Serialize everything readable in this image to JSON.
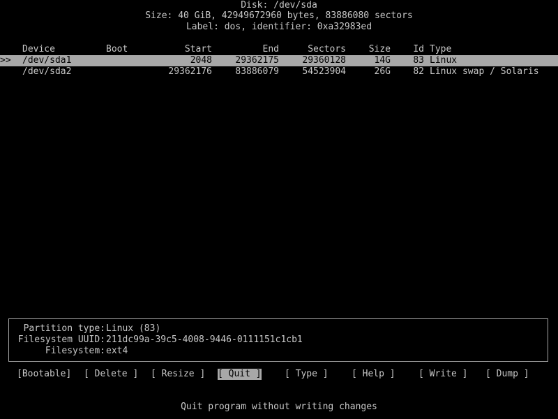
{
  "header": {
    "disk": "Disk: /dev/sda",
    "size": "Size: 40 GiB, 42949672960 bytes, 83886080 sectors",
    "label": "Label: dos, identifier: 0xa32983ed"
  },
  "table": {
    "columns": {
      "device": "Device",
      "boot": "Boot",
      "start": "Start",
      "end": "End",
      "sectors": "Sectors",
      "size": "Size",
      "id": "Id",
      "type": "Type"
    },
    "rows": [
      {
        "marker": ">>",
        "device": "/dev/sda1",
        "boot": "",
        "start": "2048",
        "end": "29362175",
        "sectors": "29360128",
        "size": "14G",
        "id": "83",
        "type": "Linux"
      },
      {
        "marker": "",
        "device": "/dev/sda2",
        "boot": "",
        "start": "29362176",
        "end": "83886079",
        "sectors": "54523904",
        "size": "26G",
        "id": "82",
        "type": "Linux swap / Solaris"
      }
    ]
  },
  "info": {
    "partition_type_label": "Partition type:",
    "partition_type_value": "Linux (83)",
    "uuid_label": "Filesystem UUID:",
    "uuid_value": "211dc99a-39c5-4008-9446-0111151c1cb1",
    "filesystem_label": "Filesystem:",
    "filesystem_value": "ext4"
  },
  "menu": {
    "bootable": "[Bootable]",
    "delete": "[ Delete ]",
    "resize": "[ Resize ]",
    "quit": "[ Quit ]",
    "type": "[ Type ]",
    "help": "[ Help ]",
    "write": "[ Write ]",
    "dump": "[ Dump ]"
  },
  "status": "Quit program without writing changes",
  "colors": {
    "background": "#000000",
    "foreground": "#c8c8c8",
    "highlight": "#a8a8a8"
  }
}
